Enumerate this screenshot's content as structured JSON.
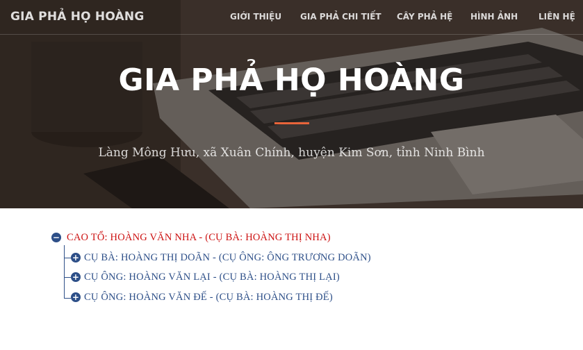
{
  "navbar": {
    "brand": "GIA PHẢ HỌ HOÀNG",
    "items": [
      {
        "label": "GIỚI THIỆU"
      },
      {
        "label": "GIA PHẢ CHI TIẾT"
      },
      {
        "label": "CÂY PHẢ HỆ"
      },
      {
        "label": "HÌNH ẢNH"
      },
      {
        "label": "LIÊN HỆ"
      }
    ]
  },
  "hero": {
    "title": "GIA PHẢ HỌ HOÀNG",
    "subtitle": "Làng Mông Hưu, xã Xuân Chính, huyện Kim Sơn, tỉnh Ninh Bình",
    "divider_color": "#e8643a"
  },
  "tree": {
    "root": {
      "label": "CAO TỔ: HOÀNG VĂN NHA - (CỤ BÀ: HOÀNG THỊ NHA)",
      "color": "#cc1111",
      "icon": "minus-circle-icon",
      "toggle": "−"
    },
    "children": [
      {
        "label": "CỤ BÀ: HOÀNG THỊ DOÃN - (CỤ ÔNG: ÔNG TRƯƠNG DOÃN)",
        "icon": "plus-circle-icon",
        "toggle": "+"
      },
      {
        "label": "CỤ ÔNG: HOÀNG VĂN LẠI - (CỤ BÀ: HOÀNG THỊ LẠI)",
        "icon": "plus-circle-icon",
        "toggle": "+"
      },
      {
        "label": "CỤ ÔNG: HOÀNG VĂN ĐẾ - (CỤ BÀ: HOÀNG THỊ ĐẾ)",
        "icon": "plus-circle-icon",
        "toggle": "+"
      }
    ],
    "child_color": "#2d4f88"
  }
}
